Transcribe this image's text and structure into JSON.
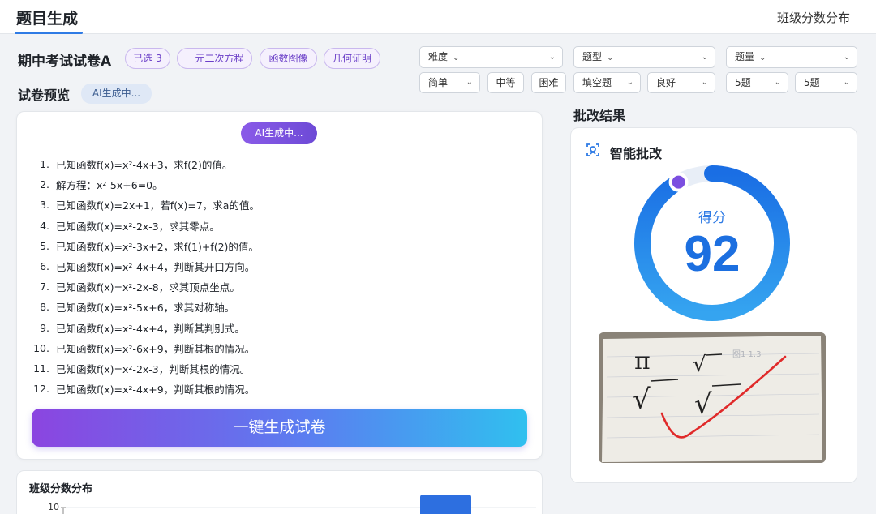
{
  "nav": {
    "title": "题目生成",
    "right_link": "班级分数分布"
  },
  "header": {
    "exam_title": "期中考试试卷A",
    "tags": [
      "已选 3",
      "一元二次方程",
      "函数图像",
      "几何证明"
    ]
  },
  "filters": {
    "difficulty": {
      "label": "难度",
      "options": [
        "简单",
        "中等",
        "困难"
      ],
      "selected": "简单"
    },
    "type": {
      "label": "题型",
      "selected": "填空题",
      "quality": "良好"
    },
    "quantity": {
      "label": "题量",
      "value1": "5题",
      "value2": "5题"
    }
  },
  "preview": {
    "title": "试卷预览",
    "status_chip": "AI生成中...",
    "card_status": "AI生成中...",
    "questions": [
      "已知函数f(x)=x²-4x+3，求f(2)的值。",
      "解方程：x²-5x+6=0。",
      "已知函数f(x)=2x+1，若f(x)=7，求a的值。",
      "已知函数f(x)=x²-2x-3，求其零点。",
      "已知函数f(x)=x²-3x+2，求f(1)+f(2)的值。",
      "已知函数f(x)=x²-4x+4，判断其开口方向。",
      "已知函数f(x)=x²-2x-8，求其顶点坐点。",
      "已知函数f(x)=x²-5x+6，求其对称轴。",
      "已知函数f(x)=x²-4x+4，判断其判别式。",
      "已知函数f(x)=x²-6x+9，判断其根的情况。",
      "已知函数f(x)=x²-2x-3，判断其根的情况。",
      "已知函数f(x)=x²-4x+9，判断其根的情况。"
    ],
    "generate_button": "一键生成试卷"
  },
  "distribution": {
    "title": "班级分数分布",
    "y_tick": "10"
  },
  "grading": {
    "section_title": "批改结果",
    "card_title": "智能批改",
    "score_label": "得分",
    "score": "92",
    "score_fraction": 0.92,
    "photo_text": {
      "symbol_pi": "π",
      "sqrt": "√",
      "faint_text": "图1 1.3"
    }
  },
  "colors": {
    "accent": "#2f7be5",
    "purple": "#7b4fe0",
    "tag_border": "#c9b8ee",
    "check_red": "#e02a2a"
  },
  "icons": [
    "chevron-down-icon",
    "smart-grading-icon",
    "checkmark-icon"
  ]
}
